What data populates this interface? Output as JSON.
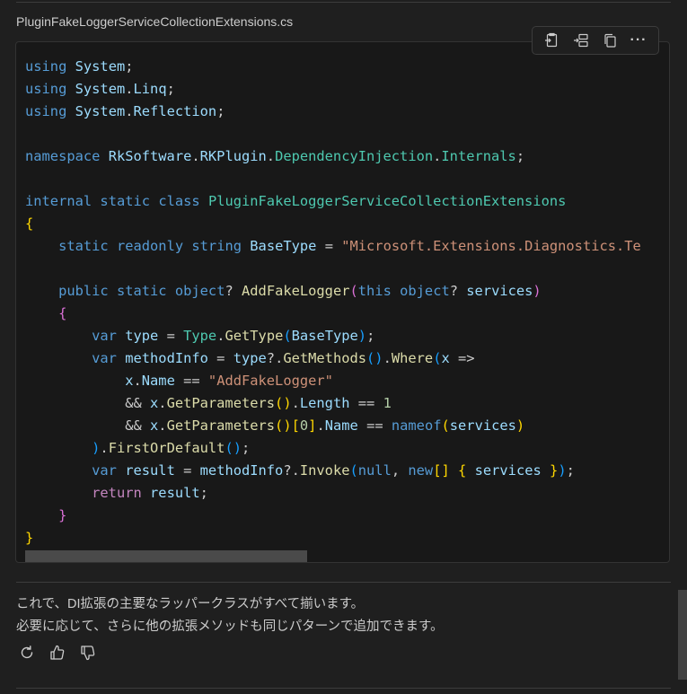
{
  "file": {
    "name": "PluginFakeLoggerServiceCollectionExtensions.cs"
  },
  "toolbar": {
    "buttons": [
      {
        "icon": "insert-into-editor-icon"
      },
      {
        "icon": "insert-into-new-file-icon"
      },
      {
        "icon": "copy-icon"
      },
      {
        "icon": "more-actions-icon",
        "glyph": "···"
      }
    ]
  },
  "code": {
    "language": "csharp",
    "lines": [
      "using System;",
      "using System.Linq;",
      "using System.Reflection;",
      "",
      "namespace RkSoftware.RKPlugin.DependencyInjection.Internals;",
      "",
      "internal static class PluginFakeLoggerServiceCollectionExtensions",
      "{",
      "    static readonly string BaseType = \"Microsoft.Extensions.Diagnostics.Te",
      "",
      "    public static object? AddFakeLogger(this object? services)",
      "    {",
      "        var type = Type.GetType(BaseType);",
      "        var methodInfo = type?.GetMethods().Where(x =>",
      "            x.Name == \"AddFakeLogger\"",
      "            && x.GetParameters().Length == 1",
      "            && x.GetParameters()[0].Name == nameof(services)",
      "        ).FirstOrDefault();",
      "        var result = methodInfo?.Invoke(null, new[] { services });",
      "        return result;",
      "    }",
      "}"
    ]
  },
  "message": {
    "line1": "これで、DI拡張の主要なラッパークラスがすべて揃います。",
    "line2": "必要に応じて、さらに他の拡張メソッドも同じパターンで追加できます。"
  },
  "actions": [
    {
      "icon": "retry-icon"
    },
    {
      "icon": "thumbs-up-icon"
    },
    {
      "icon": "thumbs-down-icon"
    }
  ],
  "colors": {
    "background": "#1f1f1f",
    "code_background": "#181818",
    "keyword": "#569cd6",
    "control_keyword": "#c586c0",
    "type": "#4ec9b0",
    "function": "#dcdcaa",
    "identifier": "#9cdcfe",
    "string": "#ce9178",
    "number": "#b5cea8"
  }
}
